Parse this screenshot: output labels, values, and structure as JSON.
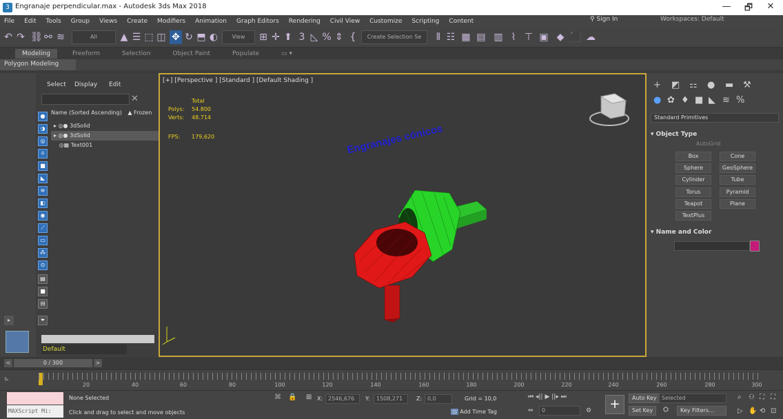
{
  "window": {
    "title": "Engranaje perpendicular.max - Autodesk 3ds Max 2018",
    "minimize": "—",
    "restore": "🗗",
    "close": "✕"
  },
  "menu": [
    "File",
    "Edit",
    "Tools",
    "Group",
    "Views",
    "Create",
    "Modifiers",
    "Animation",
    "Graph Editors",
    "Rendering",
    "Civil View",
    "Customize",
    "Scripting",
    "Content"
  ],
  "signin": "Sign In",
  "workspaces": "Workspaces: Default",
  "toolbar": {
    "filter": "All",
    "view": "View",
    "selection_set": "Create Selection Se"
  },
  "ribbon": {
    "tabs": [
      "Modeling",
      "Freeform",
      "Selection",
      "Object Paint",
      "Populate"
    ],
    "sub": "Polygon Modeling"
  },
  "scene_explorer": {
    "menu": [
      "Select",
      "Display",
      "Edit"
    ],
    "header_name": "Name (Sorted Ascending)",
    "header_frozen": "▲ Frozen",
    "rows": [
      {
        "label": "3dSolid"
      },
      {
        "label": "3dSolid"
      },
      {
        "label": "Text001"
      }
    ],
    "layer": "Default"
  },
  "viewport": {
    "label": "[+] [Perspective ] [Standard ] [Default Shading ]",
    "stats": {
      "total": "Total",
      "polys_label": "Polys:",
      "polys": "54.800",
      "verts_label": "Verts:",
      "verts": "48.714",
      "fps_label": "FPS:",
      "fps": "179,620"
    },
    "text3d": "Engranajes cónicos",
    "colors": {
      "green_gear": "#28d428",
      "red_gear": "#e01818",
      "text_blue": "#1f1fd0"
    }
  },
  "command_panel": {
    "dropdown": "Standard Primitives",
    "object_type": "Object Type",
    "autogrid": "AutoGrid",
    "buttons": [
      "Box",
      "Cone",
      "Sphere",
      "GeoSphere",
      "Cylinder",
      "Tube",
      "Torus",
      "Pyramid",
      "Teapot",
      "Plane",
      "TextPlus"
    ],
    "name_and_color": "Name and Color",
    "object_color": "#c41a78"
  },
  "time_slider": {
    "frame": "0 / 300"
  },
  "trackbar": {
    "ticks": [
      "20",
      "40",
      "60",
      "80",
      "100",
      "120",
      "140",
      "160",
      "180",
      "200",
      "220",
      "240",
      "260",
      "280",
      "300"
    ]
  },
  "status": {
    "selection": "None Selected",
    "prompt": "Click and drag to select and move objects",
    "maxscript": "MAXScript Mi:",
    "x_label": "X:",
    "x": "2546,676",
    "y_label": "Y:",
    "y": "1508,271",
    "z_label": "Z:",
    "z": "0,0",
    "grid": "Grid = 10,0",
    "add_time_tag": "Add Time Tag",
    "auto_key": "Auto Key",
    "set_key": "Set Key",
    "selected": "Selected",
    "key_filters": "Key Filters...",
    "frame_field": "0"
  }
}
